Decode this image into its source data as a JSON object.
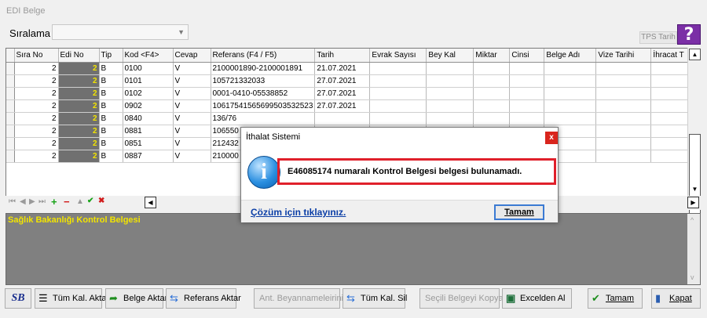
{
  "window": {
    "title": "EDI Belge"
  },
  "top": {
    "sort_label": "Sıralama",
    "sort_value": "",
    "tps_label": "TPS Tarih",
    "help_symbol": "?"
  },
  "grid": {
    "columns": [
      "Sıra No",
      "Edi No",
      "Tip",
      "Kod <F4>",
      "Cevap",
      "Referans (F4 / F5)",
      "Tarih",
      "Evrak Sayısı",
      "Bey Kal",
      "Miktar",
      "Cinsi",
      "Belge Adı",
      "Vize Tarihi",
      "İhracat T"
    ],
    "rows": [
      {
        "sira": "2",
        "edi": "2",
        "tip": "B",
        "kod": "0100",
        "cevap": "V",
        "ref": "2100001890-2100001891",
        "tarih": "21.07.2021"
      },
      {
        "sira": "2",
        "edi": "2",
        "tip": "B",
        "kod": "0101",
        "cevap": "V",
        "ref": "105721332033",
        "tarih": "27.07.2021"
      },
      {
        "sira": "2",
        "edi": "2",
        "tip": "B",
        "kod": "0102",
        "cevap": "V",
        "ref": "0001-0410-05538852",
        "tarih": "27.07.2021"
      },
      {
        "sira": "2",
        "edi": "2",
        "tip": "B",
        "kod": "0902",
        "cevap": "V",
        "ref": "106175415656995035325​23",
        "tarih": "27.07.2021"
      },
      {
        "sira": "2",
        "edi": "2",
        "tip": "B",
        "kod": "0840",
        "cevap": "V",
        "ref": "136/76",
        "tarih": ""
      },
      {
        "sira": "2",
        "edi": "2",
        "tip": "B",
        "kod": "0881",
        "cevap": "V",
        "ref": "106550",
        "tarih": ""
      },
      {
        "sira": "2",
        "edi": "2",
        "tip": "B",
        "kod": "0851",
        "cevap": "V",
        "ref": "212432",
        "tarih": ""
      },
      {
        "sira": "2",
        "edi": "2",
        "tip": "B",
        "kod": "0887",
        "cevap": "V",
        "ref": "210000",
        "tarih": ""
      }
    ]
  },
  "info_panel": {
    "title": "Sağlık Bakanlığı Kontrol Belgesi"
  },
  "bottom": {
    "sb_label": "SB",
    "tum_kal_aktar": "Tüm Kal. Aktar",
    "belge_aktar": "Belge Aktar",
    "referans_aktar": "Referans Aktar",
    "ant_beyanname": "Ant. Beyannameleirini At",
    "tum_kal_sil": "Tüm Kal. Sil",
    "secili_belge": "Seçili Belgeyi Kopyala",
    "excelden_al": "Excelden Al",
    "tamam": "Tamam",
    "kapat": "Kapat"
  },
  "dialog": {
    "title": "İthalat Sistemi",
    "close_symbol": "x",
    "icon_symbol": "i",
    "message": "E46085174 numaralı Kontrol Belgesi belgesi bulunamadı.",
    "link": "Çözüm için tıklayınız.",
    "ok": "Tamam"
  },
  "colors": {
    "edi_cell_bg": "#707070",
    "edi_cell_text": "#f2e400",
    "info_panel_bg": "#808080",
    "help_button": "#7b2fa6",
    "dialog_highlight": "#e0202b",
    "link": "#0b3ea6"
  }
}
